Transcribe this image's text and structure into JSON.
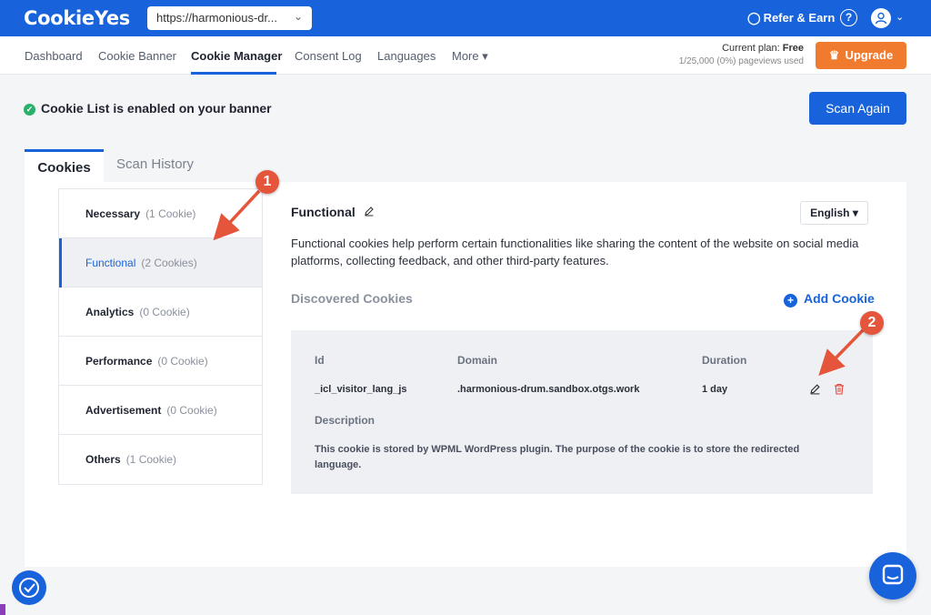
{
  "header": {
    "logo": "CookieYes",
    "site_url": "https://harmonious-dr...",
    "refer_label": "Refer & Earn",
    "help_glyph": "?"
  },
  "nav": {
    "items": [
      "Dashboard",
      "Cookie Banner",
      "Cookie Manager",
      "Consent Log",
      "Languages",
      "More ▾"
    ],
    "active": "Cookie Manager",
    "plan_label": "Current plan:",
    "plan_value": "Free",
    "pageviews": "1/25,000 (0%) pageviews used",
    "upgrade_label": "Upgrade"
  },
  "status": {
    "message": "Cookie List is enabled on your banner",
    "scan_label": "Scan Again"
  },
  "tabs": [
    "Cookies",
    "Scan History"
  ],
  "categories": [
    {
      "name": "Necessary",
      "count": "(1 Cookie)"
    },
    {
      "name": "Functional",
      "count": "(2 Cookies)"
    },
    {
      "name": "Analytics",
      "count": "(0 Cookie)"
    },
    {
      "name": "Performance",
      "count": "(0 Cookie)"
    },
    {
      "name": "Advertisement",
      "count": "(0 Cookie)"
    },
    {
      "name": "Others",
      "count": "(1 Cookie)"
    }
  ],
  "detail": {
    "title": "Functional",
    "language": "English",
    "description": "Functional cookies help perform certain functionalities like sharing the content of the website on social media platforms, collecting feedback, and other third-party features.",
    "discovered_label": "Discovered Cookies",
    "add_label": "Add Cookie"
  },
  "cookie_table": {
    "headers": {
      "id": "Id",
      "domain": "Domain",
      "duration": "Duration"
    },
    "row": {
      "id": "_icl_visitor_lang_js",
      "domain": ".harmonious-drum.sandbox.otgs.work",
      "duration": "1 day"
    },
    "description_label": "Description",
    "description": "This cookie is stored by WPML WordPress plugin. The purpose of the cookie is to store the redirected language."
  },
  "annotations": {
    "one": "1",
    "two": "2"
  },
  "colors": {
    "brand": "#1863dc",
    "upgrade": "#f07a2d",
    "annotation": "#e5553b",
    "success": "#29b06a"
  }
}
